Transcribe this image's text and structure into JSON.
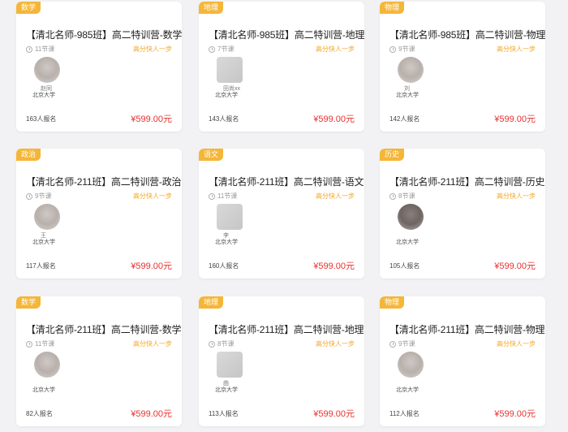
{
  "colors": {
    "tag": "#f5b638",
    "price": "#e8302e",
    "slogan": "#f4a623"
  },
  "cards": [
    {
      "tag": "数学",
      "title": "【清北名师-985班】高二特训营-数学",
      "lessons": "11节课",
      "slogan": "高分快人一步",
      "teacher_name": "赵同",
      "school": "北京大学",
      "count": "163人报名",
      "price": "¥599.00元",
      "avatar_style": "round"
    },
    {
      "tag": "地理",
      "title": "【清北名师-985班】高二特训营-地理",
      "lessons": "7节课",
      "slogan": "高分快人一步",
      "teacher_name": "田尚xx",
      "school": "北京大学",
      "count": "143人报名",
      "price": "¥599.00元",
      "avatar_style": "square"
    },
    {
      "tag": "物理",
      "title": "【清北名师-985班】高二特训营-物理",
      "lessons": "9节课",
      "slogan": "高分快人一步",
      "teacher_name": "刘",
      "school": "北京大学",
      "count": "142人报名",
      "price": "¥599.00元",
      "avatar_style": "round"
    },
    {
      "tag": "政治",
      "title": "【清北名师-211班】高二特训营-政治",
      "lessons": "9节课",
      "slogan": "高分快人一步",
      "teacher_name": "王",
      "school": "北京大学",
      "count": "117人报名",
      "price": "¥599.00元",
      "avatar_style": "round"
    },
    {
      "tag": "语文",
      "title": "【清北名师-211班】高二特训营-语文",
      "lessons": "11节课",
      "slogan": "高分快人一步",
      "teacher_name": "李",
      "school": "北京大学",
      "count": "160人报名",
      "price": "¥599.00元",
      "avatar_style": "square"
    },
    {
      "tag": "历史",
      "title": "【清北名师-211班】高二特训营-历史",
      "lessons": "8节课",
      "slogan": "高分快人一步",
      "teacher_name": "",
      "school": "北京大学",
      "count": "105人报名",
      "price": "¥599.00元",
      "avatar_style": "dark"
    },
    {
      "tag": "数学",
      "title": "【清北名师-211班】高二特训营-数学",
      "lessons": "11节课",
      "slogan": "高分快人一步",
      "teacher_name": "",
      "school": "北京大学",
      "count": "82人报名",
      "price": "¥599.00元",
      "avatar_style": "round"
    },
    {
      "tag": "地理",
      "title": "【清北名师-211班】高二特训营-地理",
      "lessons": "8节课",
      "slogan": "高分快人一步",
      "teacher_name": "曲",
      "school": "北京大学",
      "count": "113人报名",
      "price": "¥599.00元",
      "avatar_style": "square"
    },
    {
      "tag": "物理",
      "title": "【清北名师-211班】高二特训营-物理",
      "lessons": "9节课",
      "slogan": "高分快人一步",
      "teacher_name": "",
      "school": "北京大学",
      "count": "112人报名",
      "price": "¥599.00元",
      "avatar_style": "round"
    }
  ]
}
